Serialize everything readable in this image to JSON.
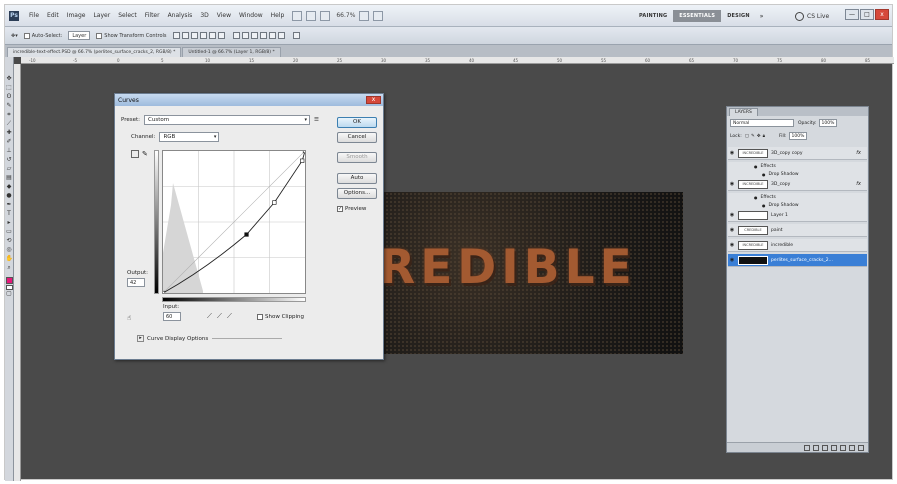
{
  "app": {
    "menu_items": [
      "File",
      "Edit",
      "Image",
      "Layer",
      "Select",
      "Filter",
      "Analysis",
      "3D",
      "View",
      "Window",
      "Help"
    ],
    "zoom": "66.7%",
    "workspaces": [
      "PAINTING",
      "ESSENTIALS",
      "DESIGN",
      "»"
    ],
    "cs_live": "CS Live",
    "win_min": "—",
    "win_max": "□",
    "win_close": "x"
  },
  "options_bar": {
    "auto_select_label": "Auto-Select:",
    "auto_select_value": "Layer",
    "show_transform_label": "Show Transform Controls"
  },
  "doc_tabs": [
    "incredible-text-effect.PSD @ 66.7% (perlites_surface_cracks_2, RGB/8) *",
    "Untitled-1 @ 66.7% (Layer 1, RGB/8) *"
  ],
  "ruler_ticks": [
    "-10",
    "-5",
    "0",
    "5",
    "10",
    "15",
    "20",
    "25",
    "30",
    "35",
    "40",
    "45",
    "50",
    "55",
    "60",
    "65",
    "70",
    "75",
    "80",
    "85"
  ],
  "canvas": {
    "headline": "REDIBLE"
  },
  "curves": {
    "title": "Curves",
    "close": "x",
    "preset_label": "Preset:",
    "preset_value": "Custom",
    "channel_label": "Channel:",
    "channel_value": "RGB",
    "output_label": "Output:",
    "output_value": "42",
    "input_label": "Input:",
    "input_value": "60",
    "show_clipping": "Show Clipping",
    "display_options": "Curve Display Options",
    "buttons": {
      "ok": "OK",
      "cancel": "Cancel",
      "smooth": "Smooth",
      "auto": "Auto",
      "options": "Options...",
      "preview": "Preview"
    },
    "curve_points": [
      [
        0,
        0
      ],
      [
        60,
        42
      ],
      [
        80,
        65
      ],
      [
        100,
        95
      ],
      [
        102,
        102
      ]
    ]
  },
  "layers": {
    "tab": "LAYERS",
    "blend_mode": "Normal",
    "opacity_label": "Opacity:",
    "opacity_value": "100%",
    "lock_label": "Lock:",
    "fill_label": "Fill:",
    "fill_value": "100%",
    "items": [
      {
        "thumb": "INCREDIBLE",
        "name": "3D_copy copy",
        "fx": "fx",
        "type": "layer"
      },
      {
        "name": "Effects",
        "type": "sub"
      },
      {
        "name": "Drop Shadow",
        "type": "sub2"
      },
      {
        "thumb": "INCREDIBLE",
        "name": "3D_copy",
        "fx": "fx",
        "type": "layer"
      },
      {
        "name": "Effects",
        "type": "sub"
      },
      {
        "name": "Drop Shadow",
        "type": "sub2"
      },
      {
        "thumb": "",
        "name": "Layer 1",
        "type": "layer"
      },
      {
        "thumb": "CREDIBLE",
        "name": "paint",
        "type": "layer"
      },
      {
        "thumb": "INCREDIBLE",
        "name": "incredible",
        "type": "layer"
      },
      {
        "thumb": "",
        "name": "perlites_surface_cracks_2...",
        "type": "selected"
      }
    ]
  }
}
